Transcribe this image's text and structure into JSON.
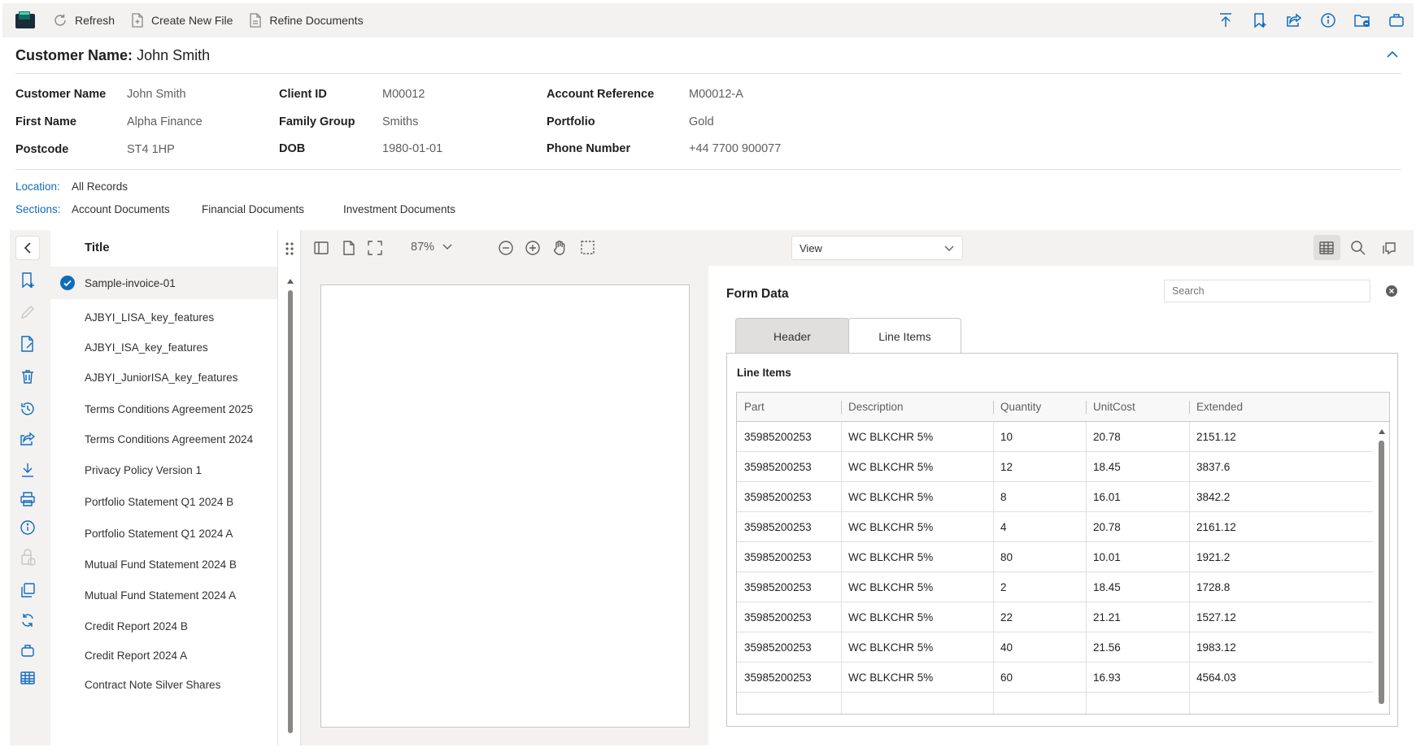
{
  "toolbar": {
    "refresh_label": "Refresh",
    "create_label": "Create New File",
    "refine_label": "Refine Documents",
    "right_icons": [
      "upload-icon",
      "bookmark-add-icon",
      "share-icon",
      "info-icon",
      "folder-link-icon",
      "briefcase-icon"
    ]
  },
  "customer": {
    "title_label": "Customer Name:",
    "title_value": "John Smith",
    "fields": {
      "customer_name": {
        "label": "Customer Name",
        "value": "John Smith"
      },
      "first_name": {
        "label": "First Name",
        "value": "Alpha Finance"
      },
      "postcode": {
        "label": "Postcode",
        "value": "ST4 1HP"
      },
      "client_id": {
        "label": "Client ID",
        "value": "M00012"
      },
      "family_group": {
        "label": "Family Group",
        "value": "Smiths"
      },
      "dob": {
        "label": "DOB",
        "value": "1980-01-01"
      },
      "account_reference": {
        "label": "Account Reference",
        "value": "M00012-A"
      },
      "portfolio": {
        "label": "Portfolio",
        "value": "Gold"
      },
      "phone_number": {
        "label": "Phone Number",
        "value": "+44 7700 900077"
      }
    },
    "location_label": "Location:",
    "location_value": "All Records",
    "sections_label": "Sections:",
    "sections": [
      "Account Documents",
      "Financial Documents",
      "Investment Documents"
    ]
  },
  "documents": {
    "header": "Title",
    "items": [
      "Sample-invoice-01",
      "AJBYI_LISA_key_features",
      "AJBYI_ISA_key_features",
      "AJBYI_JuniorISA_key_features",
      "Terms Conditions Agreement 2025",
      "Terms Conditions Agreement 2024",
      "Privacy Policy Version 1",
      "Portfolio Statement Q1 2024 B",
      "Portfolio Statement Q1 2024 A",
      "Mutual Fund Statement 2024 B",
      "Mutual Fund Statement 2024 A",
      "Credit Report 2024 B",
      "Credit Report 2024 A",
      "Contract Note Silver Shares"
    ],
    "selected": "Sample-invoice-01"
  },
  "viewer": {
    "zoom": "87%",
    "view_select": "View"
  },
  "form": {
    "title": "Form Data",
    "search_placeholder": "Search",
    "tabs": [
      "Header",
      "Line Items"
    ],
    "active_tab": "Line Items",
    "section_title": "Line Items",
    "columns": [
      "Part",
      "Description",
      "Quantity",
      "UnitCost",
      "Extended"
    ],
    "rows": [
      [
        "35985200253",
        "WC BLKCHR 5%",
        "10",
        "20.78",
        "2151.12"
      ],
      [
        "35985200253",
        "WC BLKCHR 5%",
        "12",
        "18.45",
        "3837.6"
      ],
      [
        "35985200253",
        "WC BLKCHR 5%",
        "8",
        "16.01",
        "3842.2"
      ],
      [
        "35985200253",
        "WC BLKCHR 5%",
        "4",
        "20.78",
        "2161.12"
      ],
      [
        "35985200253",
        "WC BLKCHR 5%",
        "80",
        "10.01",
        "1921.2"
      ],
      [
        "35985200253",
        "WC BLKCHR 5%",
        "2",
        "18.45",
        "1728.8"
      ],
      [
        "35985200253",
        "WC BLKCHR 5%",
        "22",
        "21.21",
        "1527.12"
      ],
      [
        "35985200253",
        "WC BLKCHR 5%",
        "40",
        "21.56",
        "1983.12"
      ],
      [
        "35985200253",
        "WC BLKCHR 5%",
        "60",
        "16.93",
        "4564.03"
      ]
    ]
  },
  "colors": {
    "accent": "#0f6cbd",
    "toolbar_bg": "#f3f2f1"
  }
}
